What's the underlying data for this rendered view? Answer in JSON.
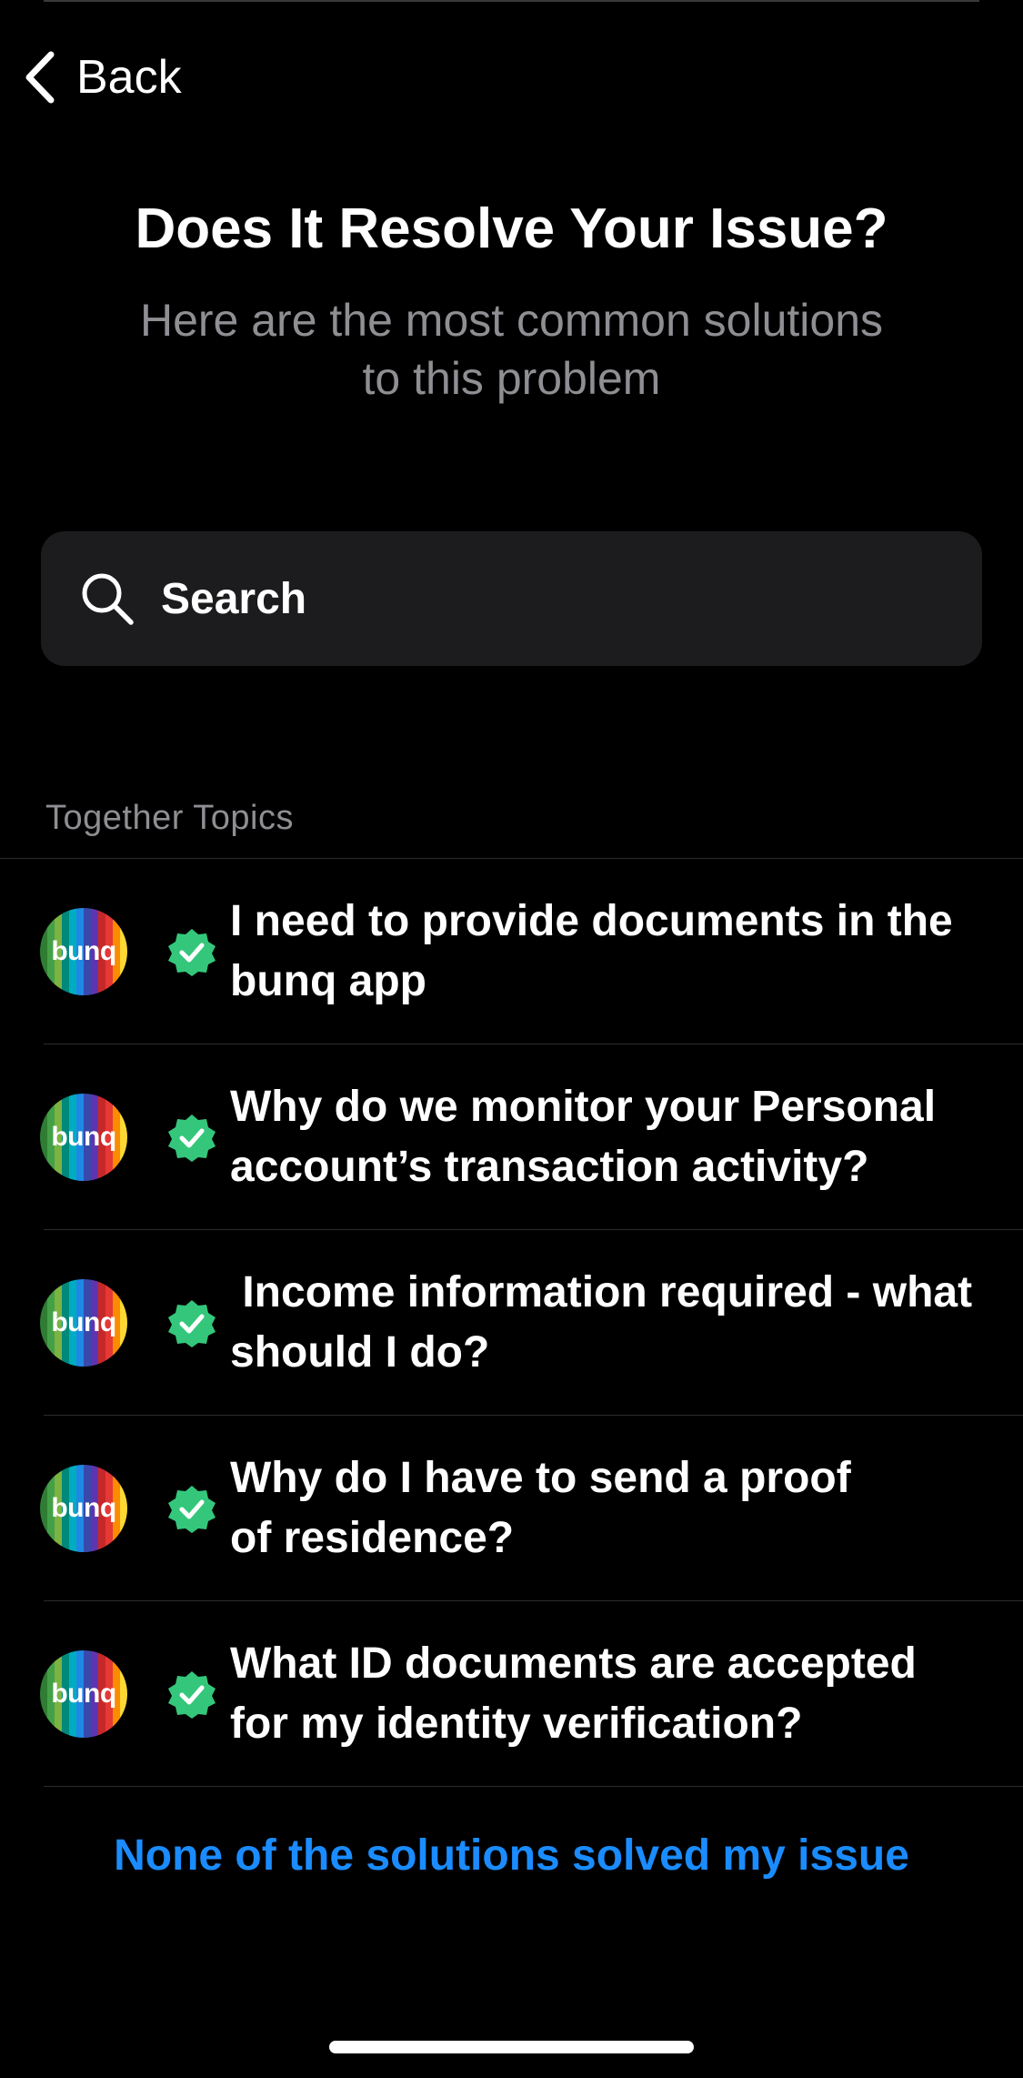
{
  "nav": {
    "back_label": "Back",
    "back_icon": "chevron-left-icon"
  },
  "header": {
    "title": "Does It Resolve Your Issue?",
    "subtitle_line1": "Here are the most common solutions",
    "subtitle_line2": "to this problem"
  },
  "search": {
    "placeholder": "Search",
    "icon": "search-icon"
  },
  "section": {
    "label": "Together Topics"
  },
  "topics": [
    {
      "logo_text": "bunq",
      "verified": true,
      "title": "I need to provide documents in the bunq app"
    },
    {
      "logo_text": "bunq",
      "verified": true,
      "title": "Why do we monitor your Personal account’s transaction activity?"
    },
    {
      "logo_text": "bunq",
      "verified": true,
      "title": " Income information required - what should I do?"
    },
    {
      "logo_text": "bunq",
      "verified": true,
      "title": "Why do I have to send a proof of residence?"
    },
    {
      "logo_text": "bunq",
      "verified": true,
      "title": "What ID documents are accepted for my identity verification?"
    }
  ],
  "footer": {
    "none_label": "None of the solutions solved my issue"
  },
  "colors": {
    "background": "#000000",
    "search_bg": "#1c1c1e",
    "muted_text": "#8e8e93",
    "link_blue": "#1a8cff",
    "verified_green": "#34c77b"
  }
}
